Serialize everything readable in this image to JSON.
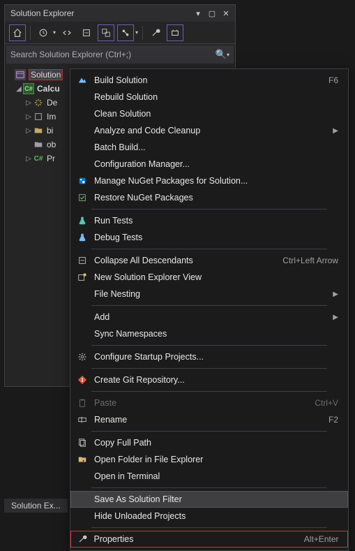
{
  "panel": {
    "title": "Solution Explorer",
    "footer_tab": "Solution Ex...",
    "search_placeholder": "Search Solution Explorer (Ctrl+;)"
  },
  "tree": {
    "root_label": "Solution",
    "project_label": "Calcu",
    "items": [
      {
        "label": "De"
      },
      {
        "label": "Im"
      },
      {
        "label": "bi"
      },
      {
        "label": "ob"
      },
      {
        "label": "Pr"
      }
    ]
  },
  "menu": {
    "groups": [
      [
        {
          "icon": "build",
          "label": "Build Solution",
          "shortcut": "F6"
        },
        {
          "icon": "",
          "label": "Rebuild Solution"
        },
        {
          "icon": "",
          "label": "Clean Solution"
        },
        {
          "icon": "",
          "label": "Analyze and Code Cleanup",
          "submenu": true
        },
        {
          "icon": "",
          "label": "Batch Build..."
        },
        {
          "icon": "",
          "label": "Configuration Manager..."
        },
        {
          "icon": "nuget",
          "label": "Manage NuGet Packages for Solution..."
        },
        {
          "icon": "restore",
          "label": "Restore NuGet Packages"
        }
      ],
      [
        {
          "icon": "flask",
          "label": "Run Tests"
        },
        {
          "icon": "flask2",
          "label": "Debug Tests"
        }
      ],
      [
        {
          "icon": "collapse",
          "label": "Collapse All Descendants",
          "shortcut": "Ctrl+Left Arrow"
        },
        {
          "icon": "newview",
          "label": "New Solution Explorer View"
        },
        {
          "icon": "",
          "label": "File Nesting",
          "submenu": true
        }
      ],
      [
        {
          "icon": "",
          "label": "Add",
          "submenu": true
        },
        {
          "icon": "",
          "label": "Sync Namespaces"
        }
      ],
      [
        {
          "icon": "gear",
          "label": "Configure Startup Projects..."
        }
      ],
      [
        {
          "icon": "git",
          "label": "Create Git Repository..."
        }
      ],
      [
        {
          "icon": "paste",
          "label": "Paste",
          "shortcut": "Ctrl+V",
          "disabled": true
        },
        {
          "icon": "rename",
          "label": "Rename",
          "shortcut": "F2"
        }
      ],
      [
        {
          "icon": "copypath",
          "label": "Copy Full Path"
        },
        {
          "icon": "folder",
          "label": "Open Folder in File Explorer"
        },
        {
          "icon": "",
          "label": "Open in Terminal"
        }
      ],
      [
        {
          "icon": "",
          "label": "Save As Solution Filter",
          "hover": true
        },
        {
          "icon": "",
          "label": "Hide Unloaded Projects"
        }
      ],
      [
        {
          "icon": "wrench",
          "label": "Properties",
          "shortcut": "Alt+Enter",
          "highlight": true
        }
      ]
    ]
  }
}
